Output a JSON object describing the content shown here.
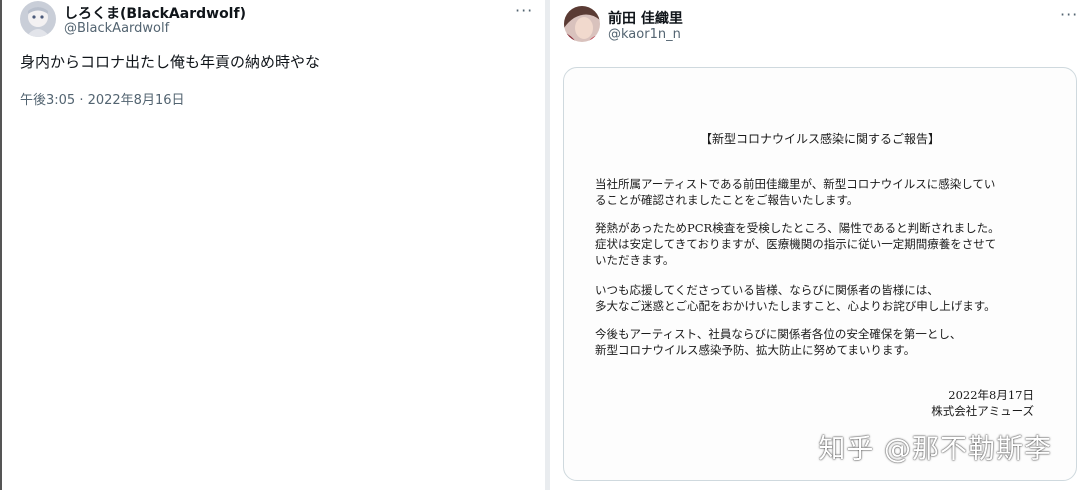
{
  "left_tweet": {
    "display_name": "しろくま(BlackAardwolf)",
    "handle": "@BlackAardwolf",
    "more_label": "···",
    "text": "身内からコロナ出たし俺も年貢の納め時やな",
    "timestamp": "午後3:05 · 2022年8月16日"
  },
  "right_tweet": {
    "display_name": "前田 佳織里",
    "handle": "@kaor1n_n",
    "more_label": "···",
    "document": {
      "title": "【新型コロナウイルス感染に関するご報告】",
      "paragraphs": [
        [
          "当社所属アーティストである前田佳織里が、新型コロナウイルスに感染してい",
          "ることが確認されましたことをご報告いたします。"
        ],
        [
          "発熱があったためPCR検査を受検したところ、陽性であると判断されました。",
          "症状は安定してきておりますが、医療機関の指示に従い一定期間療養をさせて",
          "いただきます。"
        ],
        [
          "いつも応援してくださっている皆様、ならびに関係者の皆様には、",
          "多大なご迷惑とご心配をおかけいたしますこと、心よりお詫び申し上げます。"
        ],
        [
          "今後もアーティスト、社員ならびに関係者各位の安全確保を第一とし、",
          "新型コロナウイルス感染予防、拡大防止に努めてまいります。"
        ]
      ],
      "date": "2022年8月17日",
      "company": "株式会社アミューズ"
    }
  },
  "watermark": "知乎 @那不勒斯李"
}
